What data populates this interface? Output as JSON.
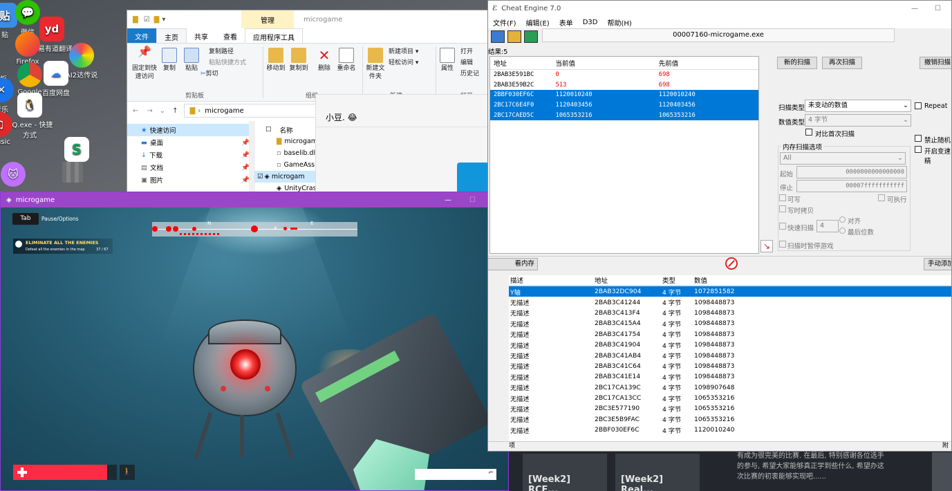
{
  "desktop_icons": [
    {
      "label": "贴",
      "x": 0
    },
    {
      "label": "微信"
    },
    {
      "label": "网易有道翻译"
    },
    {
      "label": "Firefox"
    },
    {
      "label": "Google"
    },
    {
      "label": "百度网盘"
    },
    {
      "label": "AI2达传说"
    },
    {
      "label": "QQ.exe - 快捷方式"
    },
    {
      "label": "music"
    },
    {
      "label": "站"
    },
    {
      "label": "面板"
    },
    {
      "label": "音乐"
    }
  ],
  "explorer": {
    "manage_tab": "管理",
    "folder_title": "microgame",
    "tabs": [
      "文件",
      "主页",
      "共享",
      "查看",
      "应用程序工具"
    ],
    "ribbon": {
      "pin": "固定到快速访问",
      "copy": "复制",
      "paste": "粘贴",
      "copy_path": "复制路径",
      "paste_shortcut": "粘贴快捷方式",
      "cut": "剪切",
      "move_to": "移动到",
      "copy_to": "复制到",
      "delete": "删除",
      "rename": "重命名",
      "new_folder": "新建文件夹",
      "new_item": "新建项目",
      "easy_access": "轻松访问",
      "properties": "属性",
      "open": "打开",
      "edit": "编辑",
      "history": "历史记",
      "group_clipboard": "剪贴板",
      "group_organize": "组织",
      "group_new": "新建",
      "group_open": "打开"
    },
    "path": "microgame",
    "nav": [
      "快速访问",
      "桌面",
      "下载",
      "文档",
      "图片"
    ],
    "col_name": "名称",
    "files": [
      "microgam",
      "baselib.dl",
      "GameAss",
      "microgam",
      "UnityCras"
    ]
  },
  "chat": {
    "name": "小豆.",
    "emoji": "😂"
  },
  "game": {
    "title": "microgame",
    "tab_key": "Tab",
    "pause_label": "Pause/Options",
    "objective": "ELIMINATE ALL THE ENEMIES",
    "objective_sub": "Defeat all the enemies in the map",
    "objective_count": "37 / 67",
    "compass_n": "N",
    "compass_e": "E",
    "compass_nums": "4"
  },
  "ce": {
    "title": "Cheat Engine 7.0",
    "menu": [
      "文件(F)",
      "编辑(E)",
      "表单",
      "D3D",
      "帮助(H)"
    ],
    "process": "00007160-microgame.exe",
    "results": "结果:5",
    "columns": [
      "地址",
      "当前值",
      "先前值"
    ],
    "rows": [
      {
        "addr": "2BAB3E591BC",
        "cur": "0",
        "prev": "698",
        "sel": false,
        "red": true
      },
      {
        "addr": "2BAB3E59B2C",
        "cur": "513",
        "prev": "698",
        "sel": false,
        "red": true
      },
      {
        "addr": "2BBF030EF6C",
        "cur": "1120010240",
        "prev": "1120010240",
        "sel": true,
        "red": false
      },
      {
        "addr": "2BC17C6E4F0",
        "cur": "1120403456",
        "prev": "1120403456",
        "sel": true,
        "red": false
      },
      {
        "addr": "2BC17CAED5C",
        "cur": "1065353216",
        "prev": "1065353216",
        "sel": true,
        "red": false
      }
    ],
    "btn_new_scan": "新的扫描",
    "btn_next_scan": "再次扫描",
    "btn_undo_scan": "撤销扫描",
    "scan_type_label": "扫描类型",
    "scan_type_value": "未变动的数值",
    "value_type_label": "数值类型",
    "value_type_value": "4 字节",
    "compare_first": "对比首次扫描",
    "repeat": "Repeat",
    "mem_options": "内存扫描选项",
    "mem_all": "All",
    "start_label": "起始",
    "start_value": "0000000000000000",
    "stop_label": "停止",
    "stop_value": "00007fffffffffff",
    "writable": "可写",
    "executable": "可执行",
    "copy_on_write": "写时拷贝",
    "fast_scan": "快速扫描",
    "fast_value": "4",
    "align": "对齐",
    "last_digits": "最后位数",
    "pause_game": "扫描时暂停游戏",
    "disable_random": "禁止随机",
    "enable_speedhack": "开启变速精",
    "mem_view_btn": "看内存",
    "add_manual_btn": "手动添加",
    "al_columns": [
      "描述",
      "地址",
      "类型",
      "数值"
    ],
    "al_rows": [
      {
        "d": "Y轴",
        "a": "2BAB32DC904",
        "t": "4 字节",
        "v": "1072851582",
        "sel": true
      },
      {
        "d": "无描述",
        "a": "2BAB3C41244",
        "t": "4 字节",
        "v": "1098448873"
      },
      {
        "d": "无描述",
        "a": "2BAB3C413F4",
        "t": "4 字节",
        "v": "1098448873"
      },
      {
        "d": "无描述",
        "a": "2BAB3C415A4",
        "t": "4 字节",
        "v": "1098448873"
      },
      {
        "d": "无描述",
        "a": "2BAB3C41754",
        "t": "4 字节",
        "v": "1098448873"
      },
      {
        "d": "无描述",
        "a": "2BAB3C41904",
        "t": "4 字节",
        "v": "1098448873"
      },
      {
        "d": "无描述",
        "a": "2BAB3C41AB4",
        "t": "4 字节",
        "v": "1098448873"
      },
      {
        "d": "无描述",
        "a": "2BAB3C41C64",
        "t": "4 字节",
        "v": "1098448873"
      },
      {
        "d": "无描述",
        "a": "2BAB3C41E14",
        "t": "4 字节",
        "v": "1098448873"
      },
      {
        "d": "无描述",
        "a": "2BC17CA139C",
        "t": "4 字节",
        "v": "1098907648"
      },
      {
        "d": "无描述",
        "a": "2BC17CA13CC",
        "t": "4 字节",
        "v": "1065353216"
      },
      {
        "d": "无描述",
        "a": "2BC3E577190",
        "t": "4 字节",
        "v": "1065353216"
      },
      {
        "d": "无描述",
        "a": "2BC3E5B9FAC",
        "t": "4 字节",
        "v": "1065353216"
      },
      {
        "d": "无描述",
        "a": "2BBF030EF6C",
        "t": "4 字节",
        "v": "1120010240"
      }
    ],
    "footer_left": "项",
    "footer_right": "附"
  },
  "web": {
    "card1": "[Week2] RCE...",
    "card2": "[Week2] Real...",
    "text": "有成为很完美的比赛. 在最后, 特别感谢各位选手的参与, 希望大家能够真正学到些什么, 希望办这次比赛的初衷能够实现吧......"
  }
}
